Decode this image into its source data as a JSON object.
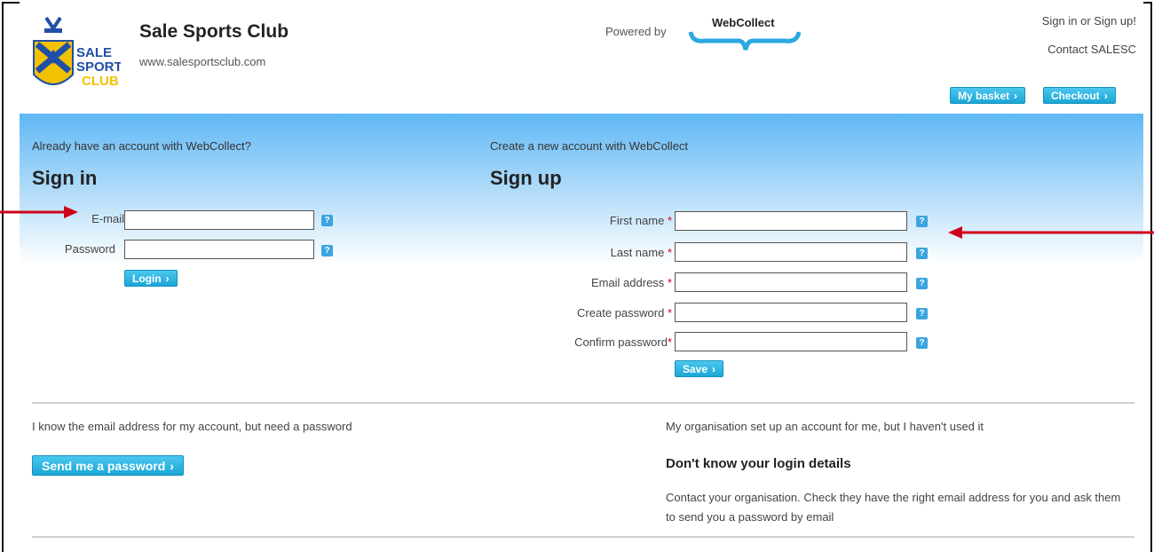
{
  "header": {
    "club_name": "Sale Sports Club",
    "club_url": "www.salesportsclub.com",
    "logo_text": [
      "SALE",
      "SPORTS",
      "CLUB"
    ],
    "powered_by": "Powered by",
    "webcollect_logo": "WebCollect",
    "signin_link": "Sign in or Sign up!",
    "contact_link": "Contact SALESC",
    "basket_button": "My basket",
    "checkout_button": "Checkout"
  },
  "signin": {
    "intro": "Already have an account with WebCollect?",
    "title": "Sign in",
    "email_label": "E-mail",
    "password_label": "Password",
    "login_button": "Login",
    "help_icon": "?"
  },
  "signup": {
    "intro": "Create a new account with WebCollect",
    "title": "Sign up",
    "required_marker": "*",
    "fields": [
      {
        "label": "First name"
      },
      {
        "label": "Last name"
      },
      {
        "label": "Email address"
      },
      {
        "label": "Create password"
      },
      {
        "label": "Confirm password"
      }
    ],
    "save_button": "Save"
  },
  "password_help": {
    "text": "I know the email address for my account, but need a password",
    "button": "Send me a password"
  },
  "org_help": {
    "text": "My organisation set up an account for me, but I haven't used it",
    "subtitle": "Don't know your login details",
    "body": "Contact your organisation. Check they have the right email address for you and ask them to send you a password by email"
  },
  "colors": {
    "accent_blue": "#1ba6d7",
    "panel_blue": "#5fb8f5",
    "arrow_red": "#d0021b",
    "club_gold": "#f2c200",
    "club_blue": "#1f4fa8"
  },
  "icons": {
    "chevron": "›",
    "arrow": "red-arrow"
  }
}
